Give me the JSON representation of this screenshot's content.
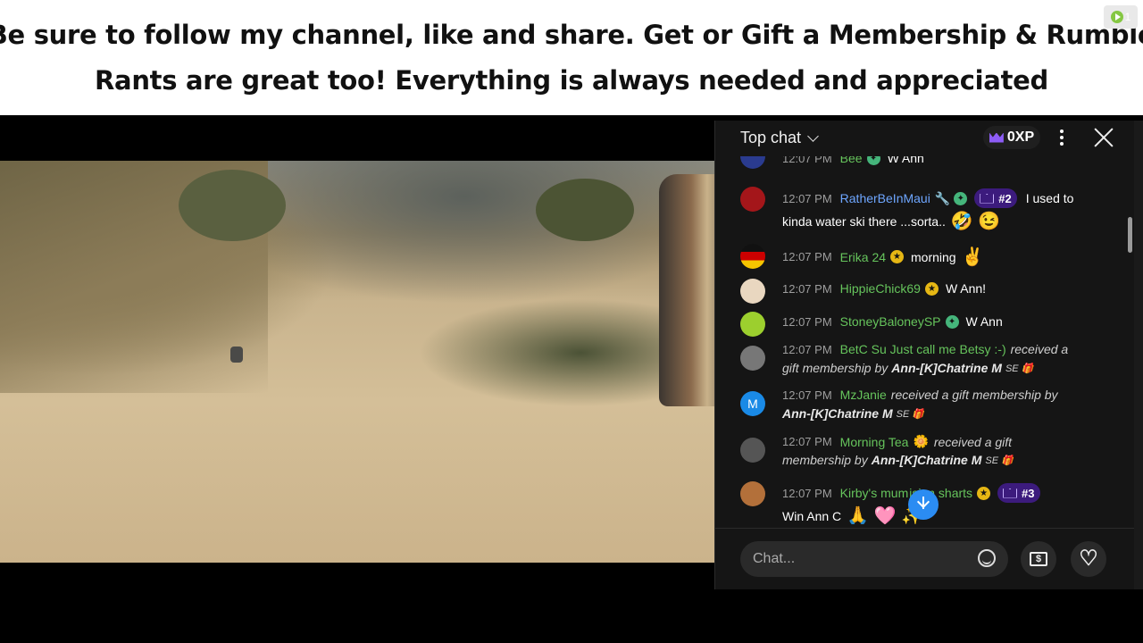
{
  "banner": {
    "line1": "Be sure to follow my channel, like and share. Get or Gift a Membership & Rumble",
    "line2": "Rants are great too! Everything is always needed and appreciated"
  },
  "corner_badge": {
    "count": "1",
    "icon": "rumble-play-icon"
  },
  "chat": {
    "header": {
      "title": "Top chat",
      "xp": "0XP"
    },
    "messages": [
      {
        "time": "12:07 PM",
        "user": "Bee",
        "text": "W Ann"
      },
      {
        "time": "12:07 PM",
        "user": "RatherBeInMaui",
        "rank": "#2",
        "text": "I used to",
        "text2": "kinda water ski there ...sorta..",
        "emoji": "🤣 😉"
      },
      {
        "time": "12:07 PM",
        "user": "Erika 24",
        "text": "morning",
        "emoji": "✌️"
      },
      {
        "time": "12:07 PM",
        "user": "HippieChick69",
        "text": "W Ann!"
      },
      {
        "time": "12:07 PM",
        "user": "StoneyBaloneySP",
        "text": "W Ann"
      },
      {
        "time": "12:07 PM",
        "user": "BetC Su Just call me Betsy :-)",
        "text": "received a",
        "text2a": "gift membership by",
        "text2b": "Ann-[K]Chatrine M",
        "se": "SE 🎁"
      },
      {
        "time": "12:07 PM",
        "user": "MzJanie",
        "avatar_letter": "M",
        "text": "received a gift membership by",
        "text2b": "Ann-[K]Chatrine M",
        "se": "SE 🎁"
      },
      {
        "time": "12:07 PM",
        "user": "Morning Tea",
        "user_emoji": "🌼",
        "text": "received a gift",
        "text2a": "membership by",
        "text2b": "Ann-[K]Chatrine M",
        "se": "SE 🎁"
      },
      {
        "time": "12:07 PM",
        "user": "Kirby's mum",
        "user_tail": "ision sharts",
        "rank": "#3",
        "text": "Win Ann C",
        "emoji": "🙏 🩷 ✨"
      }
    ],
    "input_placeholder": "Chat..."
  }
}
